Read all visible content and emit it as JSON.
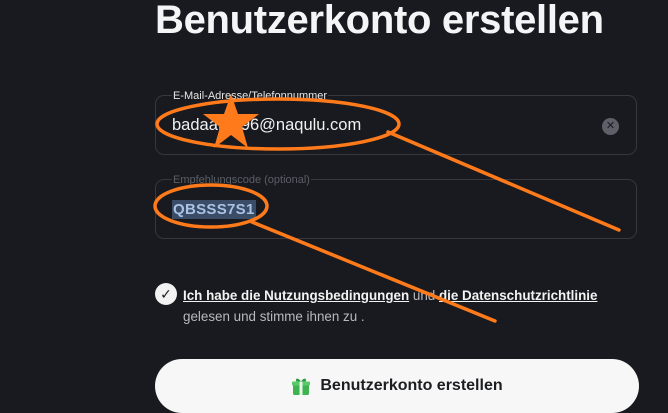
{
  "page": {
    "title": "Benutzerkonto erstellen"
  },
  "form": {
    "email": {
      "label": "E-Mail-Adresse/Telefonnummer",
      "value": "badaaf2296@naqulu.com",
      "clear_icon": "clear-circle-x-icon"
    },
    "referral": {
      "label": "Empfehlungscode (optional)",
      "value": "QBSSS7S1"
    },
    "terms": {
      "checked": true,
      "terms_link": "Ich habe die Nutzungsbedingungen",
      "and_text": "und",
      "privacy_link": "die Datenschutzrichtlinie",
      "suffix": "gelesen und stimme ihnen zu ."
    },
    "submit": {
      "icon": "gift-icon",
      "label": "Benutzerkonto erstellen"
    }
  },
  "annotation": {
    "color": "#ff7a1a"
  }
}
